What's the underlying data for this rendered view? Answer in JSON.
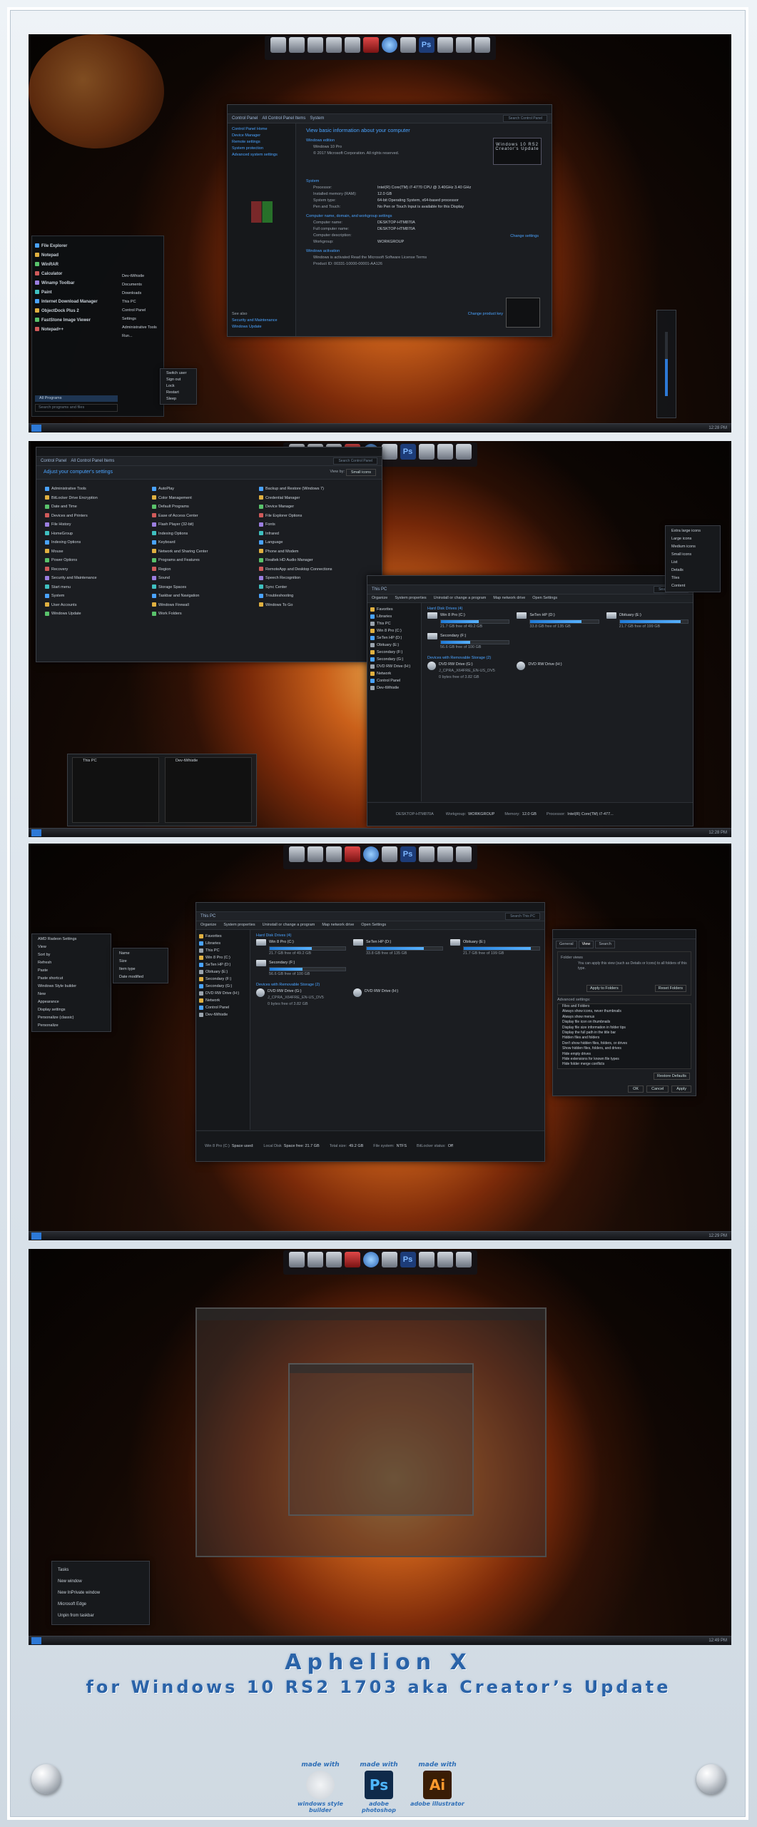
{
  "colors": {
    "accent": "#4aa3ff",
    "footer_text": "#2a63a8",
    "window_bg": "#1b1d21"
  },
  "footer": {
    "title_line1": "Aphelion X",
    "title_line2": "for Windows 10 RS2 1703 aka Creator’s Update",
    "badges": [
      {
        "made": "made with",
        "logo": "",
        "cap": "windows style builder"
      },
      {
        "made": "made with",
        "logo": "Ps",
        "cap": "adobe photoshop"
      },
      {
        "made": "made with",
        "logo": "Ai",
        "cap": "adobe illustrator"
      }
    ]
  },
  "shot1": {
    "system": {
      "breadcrumb": [
        "Control Panel",
        "All Control Panel Items",
        "System"
      ],
      "search_placeholder": "Search Control Panel",
      "left_links": [
        "Control Panel Home",
        "Device Manager",
        "Remote settings",
        "System protection",
        "Advanced system settings"
      ],
      "see_also": [
        "See also",
        "Security and Maintenance",
        "Windows Update"
      ],
      "heading": "View basic information about your computer",
      "edition_label": "Windows edition",
      "edition": "Windows 10 Pro",
      "copyright": "© 2017 Microsoft Corporation. All rights reserved.",
      "logo_text": "Windows 10 RS2 Creator's Update",
      "system_label": "System",
      "specs": [
        {
          "k": "Processor:",
          "v": "Intel(R) Core(TM) i7-4770 CPU @ 3.40GHz  3.40 GHz"
        },
        {
          "k": "Installed memory (RAM):",
          "v": "12.0 GB"
        },
        {
          "k": "System type:",
          "v": "64-bit Operating System, x64-based processor"
        },
        {
          "k": "Pen and Touch:",
          "v": "No Pen or Touch Input is available for this Display"
        }
      ],
      "name_label": "Computer name, domain, and workgroup settings",
      "names": [
        {
          "k": "Computer name:",
          "v": "DESKTOP-HTM870A"
        },
        {
          "k": "Full computer name:",
          "v": "DESKTOP-HTM870A"
        },
        {
          "k": "Computer description:",
          "v": ""
        },
        {
          "k": "Workgroup:",
          "v": "WORKGROUP"
        }
      ],
      "change_settings": "Change settings",
      "activation_label": "Windows activation",
      "activated": "Windows is activated  Read the Microsoft Software License Terms",
      "product_id": "Product ID: 00331-10000-00001-AA126",
      "change_key": "Change product key"
    },
    "start_menu": {
      "pinned": [
        "File Explorer",
        "Notepad",
        "WinRAR",
        "Calculator",
        "Winamp Toolbar",
        "Paint",
        "Internet Download Manager",
        "ObjectDock Plus 2",
        "FastStone Image Viewer",
        "Notepad++"
      ],
      "all_programs": "All Programs",
      "search_placeholder": "Search programs and files",
      "right": [
        "Dev-tWhistle",
        "Documents",
        "Downloads",
        "This PC",
        "Control Panel",
        "Settings",
        "Administrative Tools",
        "Run..."
      ],
      "power": [
        "Switch user",
        "Sign out",
        "Lock",
        "Restart",
        "Sleep"
      ]
    },
    "clock": "12:28 PM"
  },
  "shot2": {
    "cp": {
      "breadcrumb": [
        "Control Panel",
        "All Control Panel Items"
      ],
      "search_placeholder": "Search Control Panel",
      "heading": "Adjust your computer's settings",
      "view_by": "View by:",
      "view_value": "Small icons",
      "col1": [
        "Administrative Tools",
        "BitLocker Drive Encryption",
        "Date and Time",
        "Devices and Printers",
        "File History",
        "HomeGroup",
        "Indexing Options",
        "Mouse",
        "Power Options",
        "Recovery",
        "Security and Maintenance",
        "Start menu",
        "System",
        "User Accounts",
        "Windows Update"
      ],
      "col2": [
        "AutoPlay",
        "Color Management",
        "Default Programs",
        "Ease of Access Center",
        "Flash Player (32-bit)",
        "Indexing Options",
        "Keyboard",
        "Network and Sharing Center",
        "Programs and Features",
        "Region",
        "Sound",
        "Storage Spaces",
        "Taskbar and Navigation",
        "Windows Firewall",
        "Work Folders"
      ],
      "col3": [
        "Backup and Restore (Windows 7)",
        "Credential Manager",
        "Device Manager",
        "File Explorer Options",
        "Fonts",
        "Infrared",
        "Language",
        "Phone and Modem",
        "Realtek HD Audio Manager",
        "RemoteApp and Desktop Connections",
        "Speech Recognition",
        "Sync Center",
        "Troubleshooting",
        "Windows To Go"
      ]
    },
    "thispc": {
      "title": "This PC",
      "search_placeholder": "Search This PC",
      "ribbon": [
        "Organize",
        "System properties",
        "Uninstall or change a program",
        "Map network drive",
        "Open Settings"
      ],
      "nav": [
        "Favorites",
        "Libraries",
        "This PC",
        "Win 8 Pro (C:)",
        "SeTen HP (D:)",
        "Obituary (E:)",
        "Secondary (F:)",
        "Secondary (G:)",
        "DVD RW Drive (H:)",
        "Network",
        "Control Panel",
        "Dev-tWhistle"
      ],
      "hdd_header": "Hard Disk Drives (4)",
      "drives": [
        {
          "name": "Win 8 Pro (C:)",
          "free": "21.7 GB free of 49.2 GB",
          "used": 0.56
        },
        {
          "name": "SeTen HP (D:)",
          "free": "33.8 GB free of 135 GB",
          "used": 0.75
        },
        {
          "name": "Obituary (E:)",
          "free": "21.7 GB free of 199 GB",
          "used": 0.89
        },
        {
          "name": "Secondary (F:)",
          "free": "56.6 GB free of 100 GB",
          "used": 0.43
        }
      ],
      "removable_header": "Devices with Removable Storage (2)",
      "removable": [
        {
          "name": "DVD RW Drive (G:)",
          "sub": "J_CPRA_X64FRE_EN-US_DV5",
          "free": "0 bytes free of 3.82 GB"
        },
        {
          "name": "DVD RW Drive (H:)",
          "sub": "",
          "free": ""
        }
      ],
      "details": [
        {
          "k": "DESKTOP-HTM870A",
          "v": ""
        },
        {
          "k": "Workgroup:",
          "v": "WORKGROUP"
        },
        {
          "k": "Memory:",
          "v": "12.0 GB"
        },
        {
          "k": "Processor:",
          "v": "Intel(R) Core(TM) i7-477..."
        }
      ]
    },
    "view_menu": [
      "Extra large icons",
      "Large icons",
      "Medium icons",
      "Small icons",
      "List",
      "Details",
      "Tiles",
      "Content"
    ],
    "thumbs": [
      "This PC",
      "Dev-tWhistle"
    ],
    "clock": "12:28 PM"
  },
  "shot3": {
    "context_menu": [
      "AMD Radeon Settings",
      "View",
      "Sort by",
      "Refresh",
      "Paste",
      "Paste shortcut",
      "Windows Style builder",
      "New",
      "Appearance",
      "Display settings",
      "Personalize (classic)",
      "Personalize"
    ],
    "submenu": [
      "Name",
      "Size",
      "Item type",
      "Date modified"
    ],
    "status": [
      {
        "k": "Win 8 Pro (C:)",
        "v": "Space used:"
      },
      {
        "k": "Local Disk",
        "v": "Space free: 21.7 GB"
      },
      {
        "k": "Total size:",
        "v": "49.2 GB"
      },
      {
        "k": "File system:",
        "v": "NTFS"
      },
      {
        "k": "BitLocker status:",
        "v": "Off"
      }
    ],
    "folder_options": {
      "tabs": [
        "General",
        "View",
        "Search"
      ],
      "folder_views": "Folder views",
      "folder_views_desc": "You can apply this view (such as Details or Icons) to all folders of this type.",
      "apply_btn": "Apply to Folders",
      "reset_btn": "Reset Folders",
      "advanced": "Advanced settings:",
      "items": [
        "Files and Folders",
        "Always show icons, never thumbnails",
        "Always show menus",
        "Display file icon on thumbnails",
        "Display file size information in folder tips",
        "Display the full path in the title bar",
        "Hidden files and folders",
        "Don't show hidden files, folders, or drives",
        "Show hidden files, folders, and drives",
        "Hide empty drives",
        "Hide extensions for known file types",
        "Hide folder merge conflicts"
      ],
      "restore_btn": "Restore Defaults",
      "buttons": [
        "OK",
        "Cancel",
        "Apply"
      ]
    },
    "clock": "12:29 PM"
  },
  "shot4": {
    "jumplist": [
      "Tasks",
      "New window",
      "New InPrivate window",
      "Microsoft Edge",
      "Unpin from taskbar"
    ],
    "clock": "12:49 PM"
  }
}
